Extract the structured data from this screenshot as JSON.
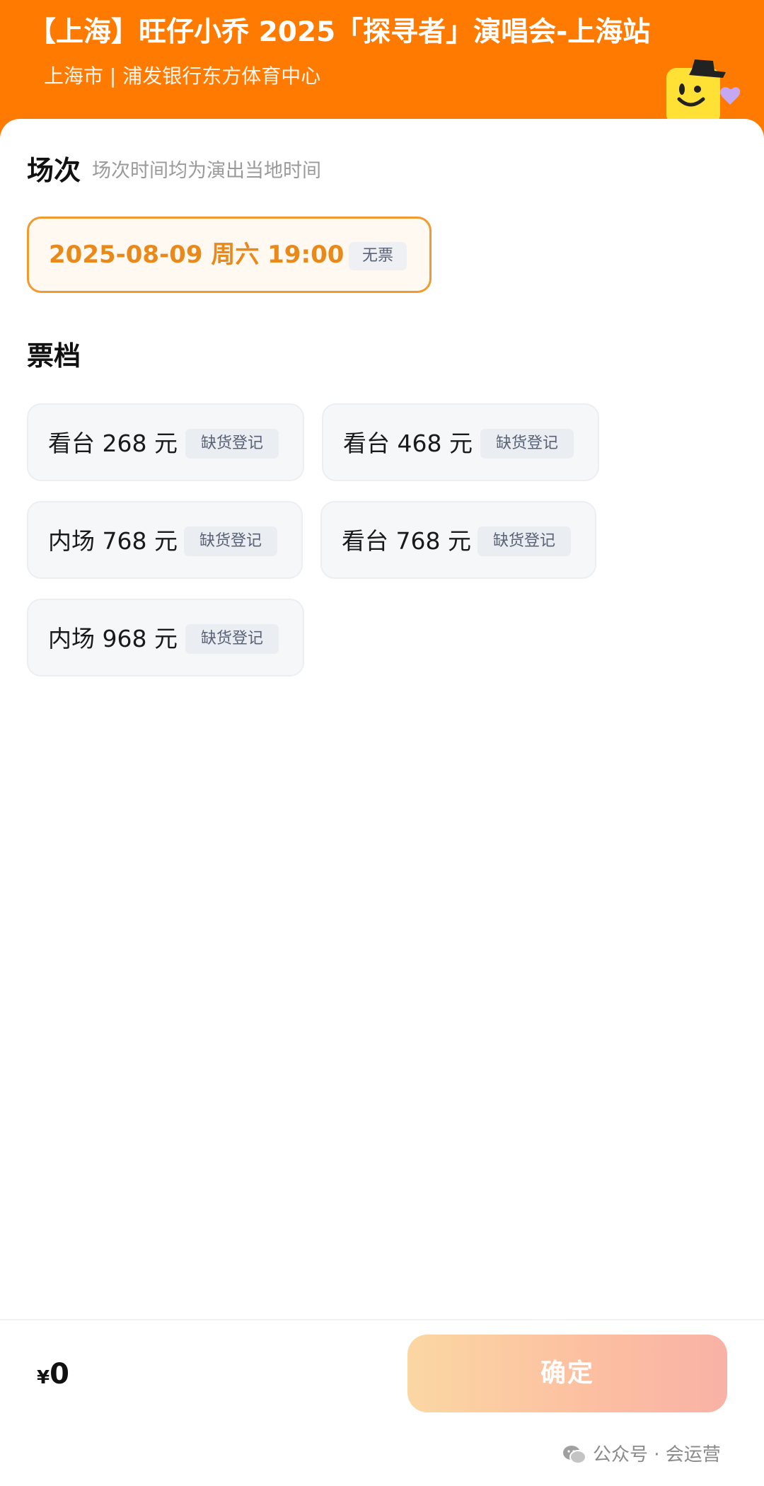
{
  "header": {
    "title": "【上海】旺仔小乔 2025「探寻者」演唱会-上海站",
    "venue": "上海市 | 浦发银行东方体育中心",
    "mascot_icon": "mascot-icon"
  },
  "session": {
    "heading": "场次",
    "hint": "场次时间均为演出当地时间",
    "items": [
      {
        "date": "2025-08-09  周六 19:00",
        "status": "无票"
      }
    ]
  },
  "tiers": {
    "heading": "票档",
    "items": [
      {
        "name": "看台 268 元",
        "badge": "缺货登记"
      },
      {
        "name": "看台 468 元",
        "badge": "缺货登记"
      },
      {
        "name": "内场 768 元",
        "badge": "缺货登记"
      },
      {
        "name": "看台 768 元",
        "badge": "缺货登记"
      },
      {
        "name": "内场 968 元",
        "badge": "缺货登记"
      }
    ]
  },
  "footer": {
    "currency": "¥",
    "amount": "0",
    "confirm_label": "确定"
  },
  "watermark": {
    "icon": "wechat-icon",
    "text": "公众号 · 会运营"
  },
  "colors": {
    "brand_orange": "#ff7a00",
    "selected_border": "#f19a2e",
    "selected_text": "#e8891a"
  }
}
